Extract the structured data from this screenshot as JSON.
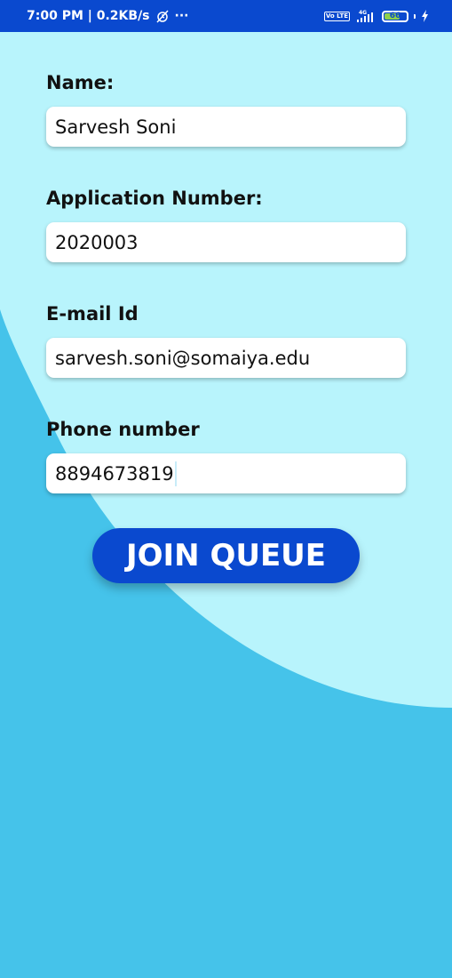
{
  "status_bar": {
    "time_speed": "7:00 PM | 0.2KB/s",
    "overflow": "···",
    "volte": "Vo LTE",
    "network": "4G",
    "battery_level": "66",
    "colors": {
      "bar": "#0a49cf",
      "battery_fill": "#8fd14a"
    }
  },
  "form": {
    "name_label": "Name:",
    "name_value": "Sarvesh Soni",
    "application_label": "Application Number:",
    "application_value": "2020003",
    "email_label": "E-mail Id",
    "email_value": "sarvesh.soni@somaiya.edu",
    "phone_label": "Phone number",
    "phone_value": "8894673819"
  },
  "actions": {
    "join_label": "JOIN QUEUE"
  },
  "colors": {
    "background": "#45c3ea",
    "light_shape": "#b8f4fc",
    "button": "#0a49cf"
  }
}
